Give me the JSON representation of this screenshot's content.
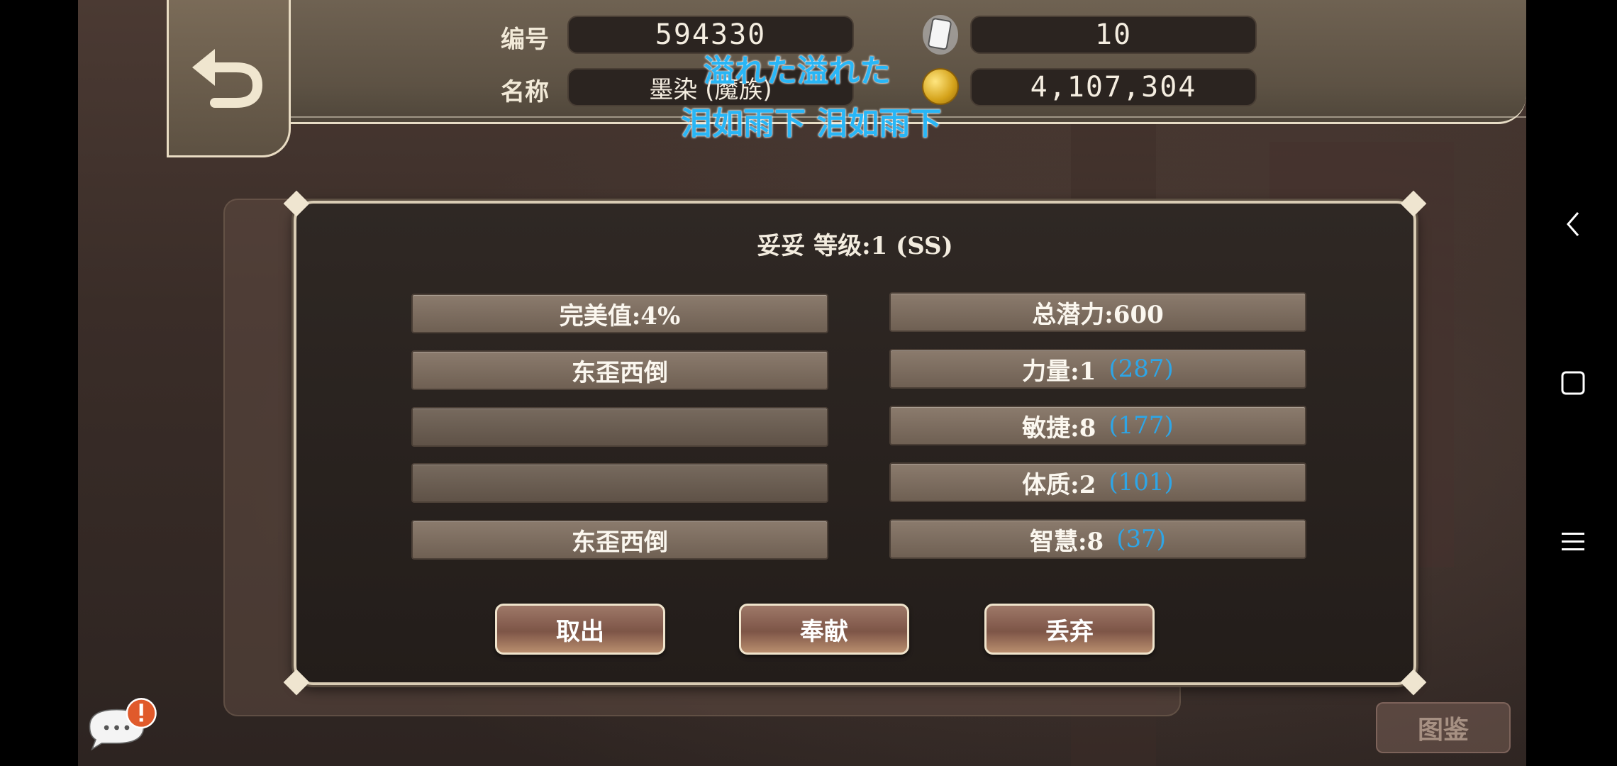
{
  "header": {
    "id_label": "编号",
    "id_value": "594330",
    "name_label": "名称",
    "name_value": "墨染 (魔族)",
    "cards_value": "10",
    "gold_value": "4,107,304"
  },
  "overlay_subtitle": {
    "line1": "溢れた溢れた",
    "line2": "泪如雨下 泪如雨下"
  },
  "dialog": {
    "title": "妥妥 等级:1 (SS)",
    "left_stats": [
      {
        "text": "完美值:4%"
      },
      {
        "text": "东歪西倒"
      },
      {
        "text": ""
      },
      {
        "text": ""
      },
      {
        "text": "东歪西倒"
      }
    ],
    "right_stats": [
      {
        "text": "总潜力:600",
        "extra": ""
      },
      {
        "text": "力量:1",
        "extra": "(287)"
      },
      {
        "text": "敏捷:8",
        "extra": "(177)"
      },
      {
        "text": "体质:2",
        "extra": "(101)"
      },
      {
        "text": "智慧:8",
        "extra": "(37)"
      }
    ],
    "buttons": {
      "take_out": "取出",
      "donate": "奉献",
      "discard": "丢弃"
    }
  },
  "background": {
    "tujian_button": "图鉴"
  },
  "colors": {
    "extra_value": "#2ea5e6",
    "subtitle": "#29b6f6"
  }
}
